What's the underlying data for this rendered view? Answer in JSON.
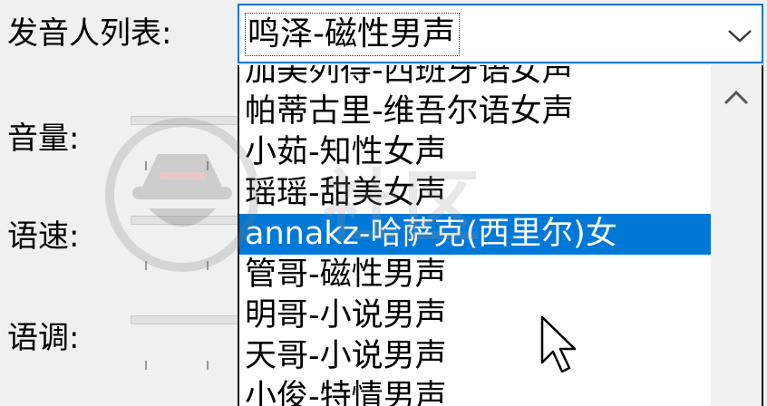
{
  "labels": {
    "speaker_list": "发音人列表:",
    "volume": "音量:",
    "speed": "语速:",
    "pitch": "语调:"
  },
  "combo": {
    "selected_value": "鸣泽-磁性男声"
  },
  "dropdown": {
    "items": [
      "加美列得-西班牙语女声",
      "帕蒂古里-维吾尔语女声",
      "小茹-知性女声",
      "瑶瑶-甜美女声",
      "annakz-哈萨克(西里尔)女",
      "管哥-磁性男声",
      "明哥-小说男声",
      "天哥-小说男声",
      "小俊-特情男声"
    ],
    "selected_index": 4
  },
  "watermark": {
    "text": "社区"
  },
  "colors": {
    "accent": "#0078d7",
    "background": "#f0f0f0",
    "list_background": "#ffffff"
  },
  "icons": {
    "combo_arrow": "chevron-down-icon",
    "scroll_up": "chevron-up-icon",
    "cursor": "mouse-pointer-icon",
    "watermark_logo": "spy-hat-logo"
  }
}
